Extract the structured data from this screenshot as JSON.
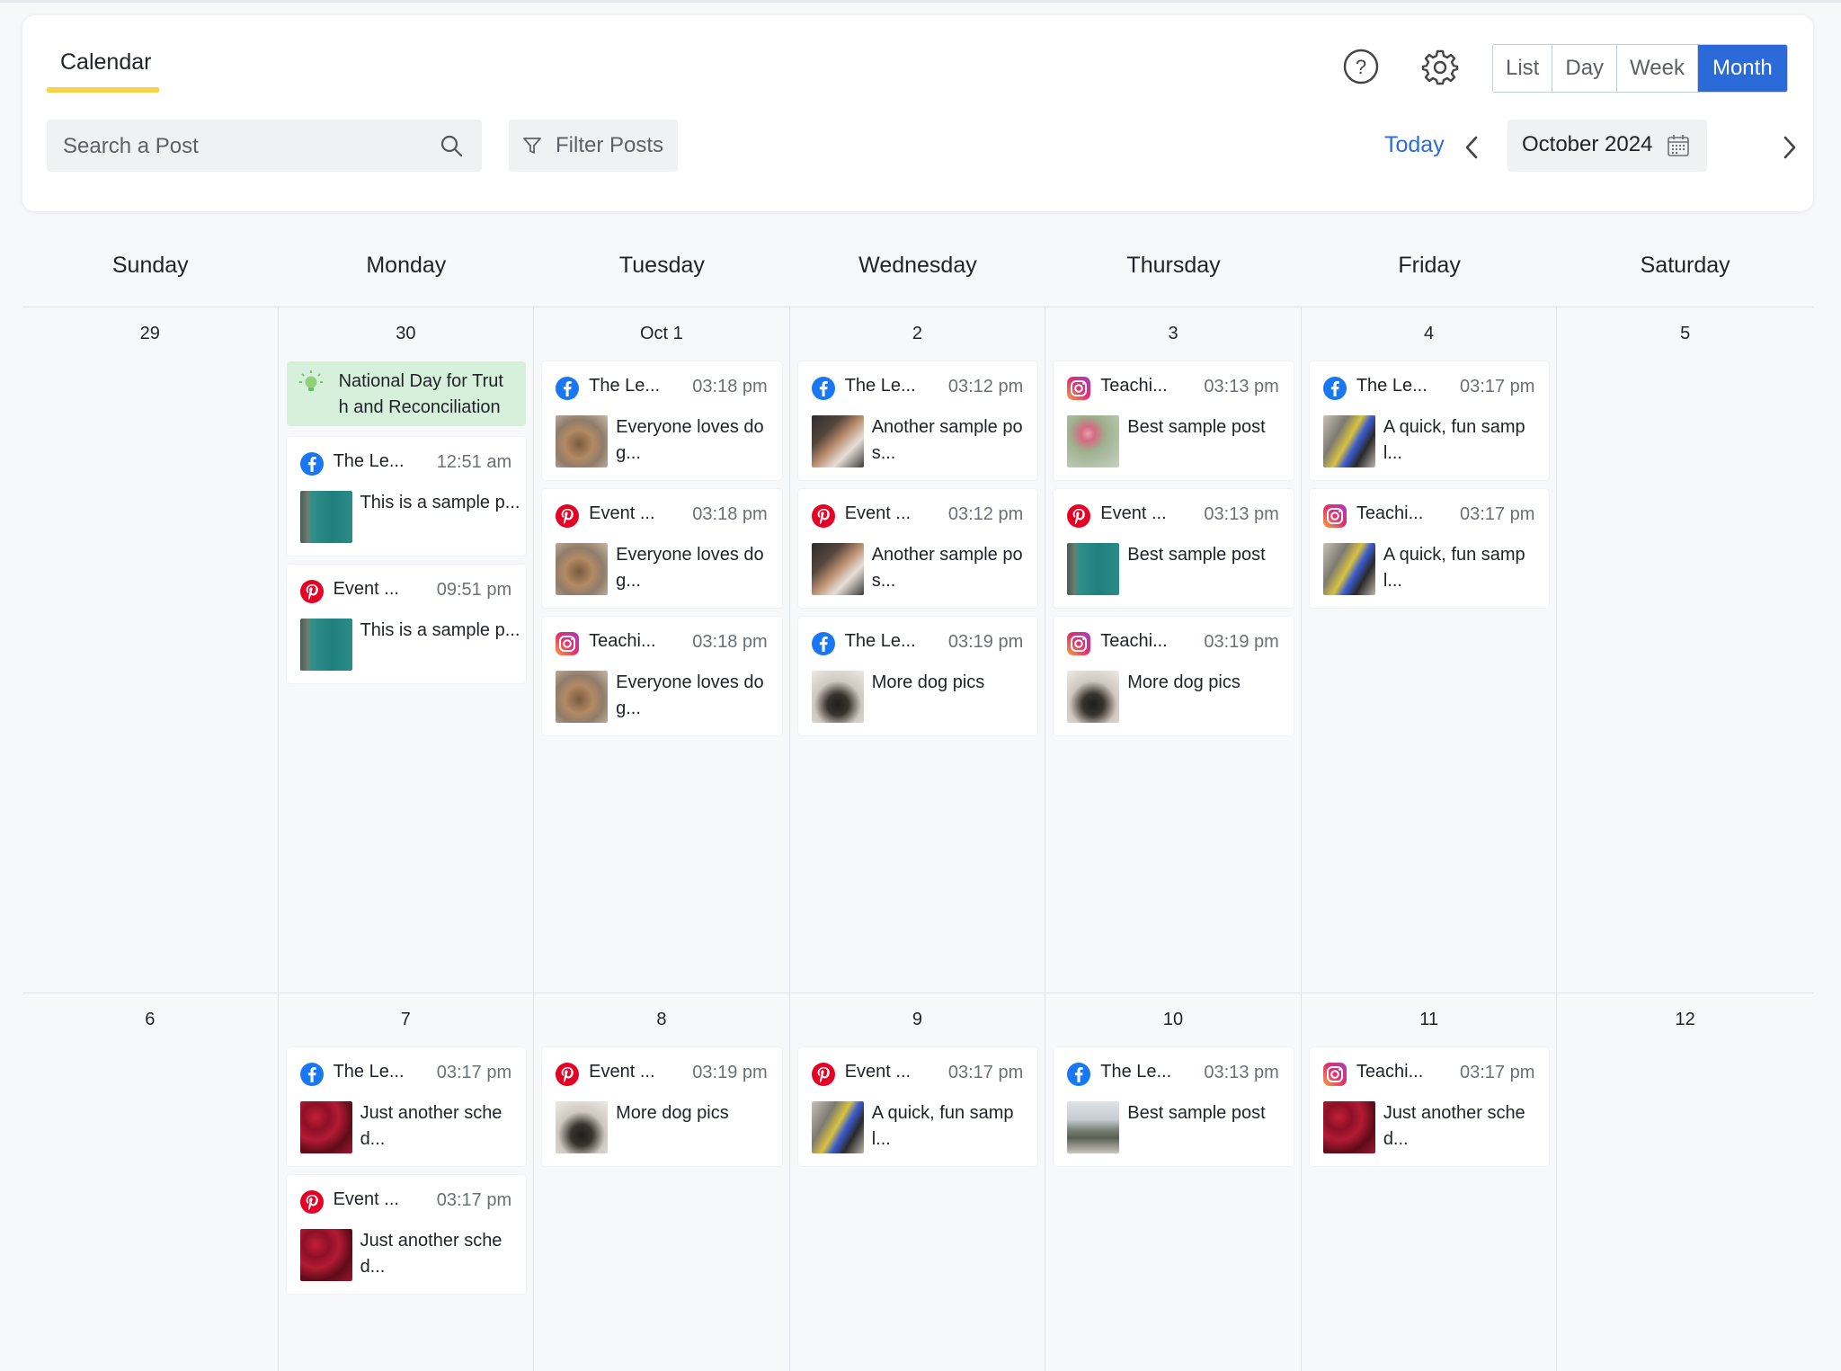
{
  "header": {
    "tab_label": "Calendar",
    "search_placeholder": "Search a Post",
    "filter_label": "Filter Posts",
    "view_buttons": [
      "List",
      "Day",
      "Week",
      "Month"
    ],
    "active_view": "Month",
    "today_label": "Today",
    "current_month": "October 2024"
  },
  "colors": {
    "accent": "#2a6bd9",
    "tab_underline": "#f5d44a",
    "holiday_bg": "#d7f0dc",
    "facebook": "#1877f2",
    "pinterest": "#e60023",
    "instagram": "#e1306c"
  },
  "weekdays": [
    "Sunday",
    "Monday",
    "Tuesday",
    "Wednesday",
    "Thursday",
    "Friday",
    "Saturday"
  ],
  "weeks": [
    {
      "days": [
        {
          "num": "29",
          "holiday": null,
          "posts": []
        },
        {
          "num": "30",
          "holiday": "National Day for Trut h and Reconciliation",
          "posts": [
            {
              "network": "facebook",
              "name": "The Le...",
              "time": "12:51 am",
              "text": "This is a sample p...",
              "thumb": "sea"
            },
            {
              "network": "pinterest",
              "name": "Event ...",
              "time": "09:51 pm",
              "text": "This is a sample p...",
              "thumb": "sea"
            }
          ]
        },
        {
          "num": "Oct 1",
          "holiday": null,
          "posts": [
            {
              "network": "facebook",
              "name": "The Le...",
              "time": "03:18 pm",
              "text": "Everyone loves do g...",
              "thumb": "dog"
            },
            {
              "network": "pinterest",
              "name": "Event ...",
              "time": "03:18 pm",
              "text": "Everyone loves do g...",
              "thumb": "dog"
            },
            {
              "network": "instagram",
              "name": "Teachi...",
              "time": "03:18 pm",
              "text": "Everyone loves do g...",
              "thumb": "dog"
            }
          ]
        },
        {
          "num": "2",
          "holiday": null,
          "posts": [
            {
              "network": "facebook",
              "name": "The Le...",
              "time": "03:12 pm",
              "text": "Another sample po s...",
              "thumb": "rock"
            },
            {
              "network": "pinterest",
              "name": "Event ...",
              "time": "03:12 pm",
              "text": "Another sample po s...",
              "thumb": "rock"
            },
            {
              "network": "facebook",
              "name": "The Le...",
              "time": "03:19 pm",
              "text": "More dog pics",
              "thumb": "dog2"
            }
          ]
        },
        {
          "num": "3",
          "holiday": null,
          "posts": [
            {
              "network": "instagram",
              "name": "Teachi...",
              "time": "03:13 pm",
              "text": "Best sample post",
              "thumb": "flowers"
            },
            {
              "network": "pinterest",
              "name": "Event ...",
              "time": "03:13 pm",
              "text": "Best sample post",
              "thumb": "sea"
            },
            {
              "network": "instagram",
              "name": "Teachi...",
              "time": "03:19 pm",
              "text": "More dog pics",
              "thumb": "dog2"
            }
          ]
        },
        {
          "num": "4",
          "holiday": null,
          "posts": [
            {
              "network": "facebook",
              "name": "The Le...",
              "time": "03:17 pm",
              "text": "A quick, fun samp l...",
              "thumb": "phone"
            },
            {
              "network": "instagram",
              "name": "Teachi...",
              "time": "03:17 pm",
              "text": "A quick, fun samp l...",
              "thumb": "phone"
            }
          ]
        },
        {
          "num": "5",
          "holiday": null,
          "posts": []
        }
      ]
    },
    {
      "days": [
        {
          "num": "6",
          "holiday": null,
          "posts": []
        },
        {
          "num": "7",
          "holiday": null,
          "posts": [
            {
              "network": "facebook",
              "name": "The Le...",
              "time": "03:17 pm",
              "text": "Just another sche d...",
              "thumb": "berries"
            },
            {
              "network": "pinterest",
              "name": "Event ...",
              "time": "03:17 pm",
              "text": "Just another sche d...",
              "thumb": "berries"
            }
          ]
        },
        {
          "num": "8",
          "holiday": null,
          "posts": [
            {
              "network": "pinterest",
              "name": "Event ...",
              "time": "03:19 pm",
              "text": "More dog pics",
              "thumb": "dog2"
            }
          ]
        },
        {
          "num": "9",
          "holiday": null,
          "posts": [
            {
              "network": "pinterest",
              "name": "Event ...",
              "time": "03:17 pm",
              "text": "A quick, fun samp l...",
              "thumb": "phone"
            }
          ]
        },
        {
          "num": "10",
          "holiday": null,
          "posts": [
            {
              "network": "facebook",
              "name": "The Le...",
              "time": "03:13 pm",
              "text": "Best sample post",
              "thumb": "mountain"
            }
          ]
        },
        {
          "num": "11",
          "holiday": null,
          "posts": [
            {
              "network": "instagram",
              "name": "Teachi...",
              "time": "03:17 pm",
              "text": "Just another sche d...",
              "thumb": "berries"
            }
          ]
        },
        {
          "num": "12",
          "holiday": null,
          "posts": []
        }
      ]
    }
  ]
}
